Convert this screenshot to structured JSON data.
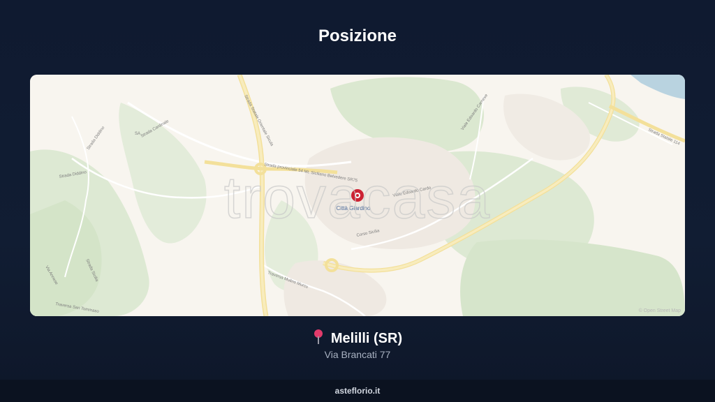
{
  "header": {
    "title": "Posizione"
  },
  "map": {
    "watermark": "trovacasa",
    "marker_label": "Città Giardino",
    "attribution": "© Open Street Map",
    "street_labels": {
      "strada_statale_orientale_sicula": "Strada Statale Orientale Sicula",
      "strada_provinciale": "Strada provinciale 54 Mt. Siciliano Belvedere SR75",
      "strada_diddino": "Strada Diddino",
      "strada_diddino_2": "Strada Diddino",
      "strada_cardinale": "Strada Cardinale",
      "viale_edoardo": "Viale Edoardo Cardo",
      "viale_edoardo_2": "Viale Edoardo Carnese",
      "corso_sicilia": "Corso Sicilia",
      "strada_statale_114": "Strada Statale 114",
      "traversa_mulino": "Traversa Mulino Murcu",
      "traversa_san_tommaso": "Traversa San Tommaso",
      "via_annese": "Via Annese",
      "ss_sa": "SA",
      "strada_sicilia": "Strada Sicilia"
    },
    "colors": {
      "park": "#dce8d2",
      "road_major": "#f6e7a6",
      "road_minor": "#ffffff",
      "land": "#f8f5ef",
      "water": "#b9d3e0",
      "marker": "#cc2233"
    }
  },
  "location": {
    "name": "Melilli (SR)",
    "address": "Via Brancati 77",
    "pin_icon": "map-pin-icon",
    "pin_color": "#e23b6b"
  },
  "footer": {
    "site": "asteflorio.it"
  }
}
